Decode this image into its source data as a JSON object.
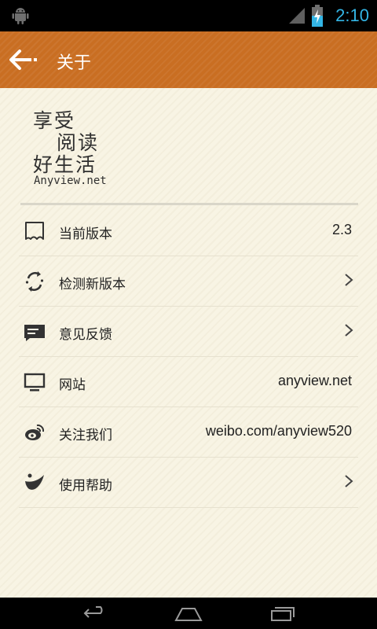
{
  "status_bar": {
    "time": "2:10",
    "icons": [
      "android-debug-icon",
      "signal-icon",
      "battery-charging-icon"
    ]
  },
  "action_bar": {
    "title": "关于",
    "back_icon": "back-arrow-icon"
  },
  "logo": {
    "line1": "享受",
    "line2": "阅读",
    "line3": "好生活",
    "url": "Anyview.net"
  },
  "settings": {
    "items": [
      {
        "icon": "version-tag-icon",
        "label": "当前版本",
        "value": "2.3",
        "chevron": false
      },
      {
        "icon": "refresh-icon",
        "label": "检测新版本",
        "value": "",
        "chevron": true
      },
      {
        "icon": "feedback-icon",
        "label": "意见反馈",
        "value": "",
        "chevron": true
      },
      {
        "icon": "monitor-icon",
        "label": "网站",
        "value": "anyview.net",
        "chevron": false
      },
      {
        "icon": "weibo-icon",
        "label": "关注我们",
        "value": "weibo.com/anyview520",
        "chevron": false
      },
      {
        "icon": "help-icon",
        "label": "使用帮助",
        "value": "",
        "chevron": true
      }
    ]
  },
  "navigation_bar": {
    "buttons": [
      "back-nav-icon",
      "home-nav-icon",
      "recents-nav-icon"
    ]
  },
  "colors": {
    "action_bar": "#c96e22",
    "status_text": "#33b5e5",
    "background": "#f8f4e4"
  }
}
